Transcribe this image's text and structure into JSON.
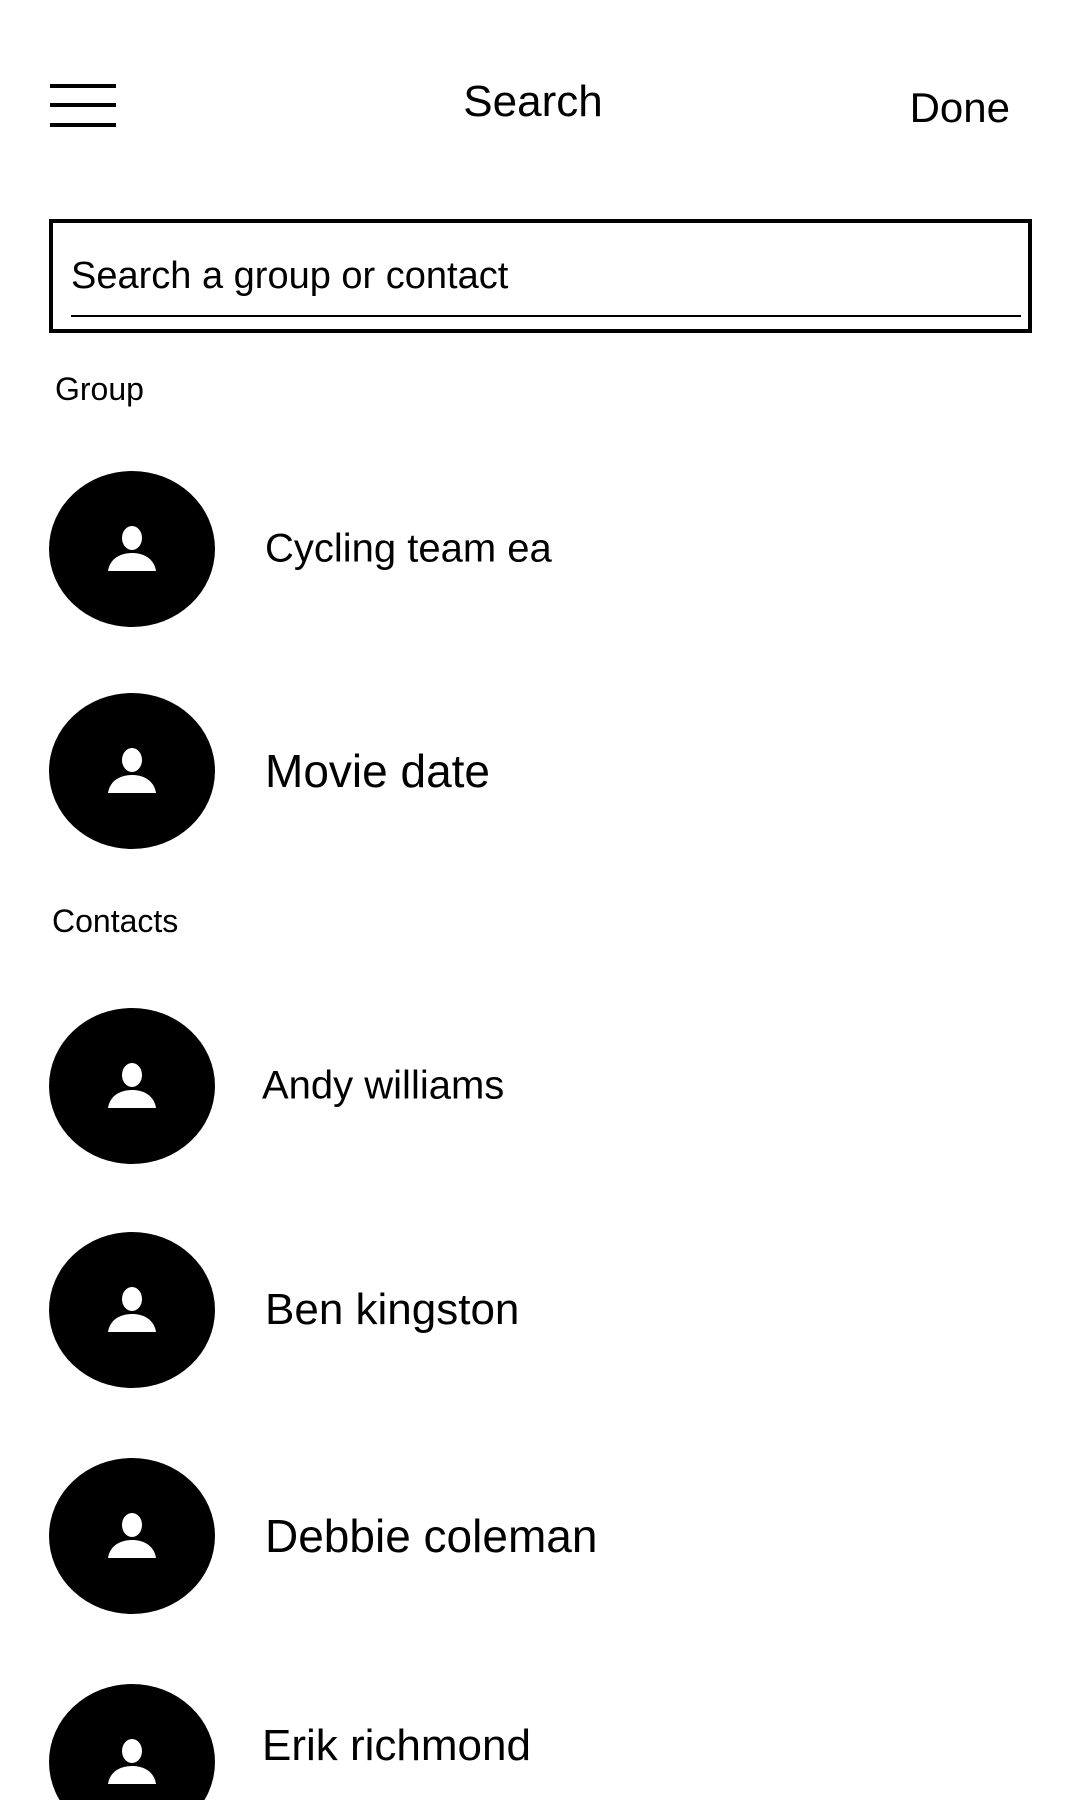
{
  "header": {
    "title": "Search",
    "done_label": "Done",
    "menu_icon": "hamburger-menu-icon"
  },
  "search": {
    "placeholder": "Search a group or contact",
    "value": ""
  },
  "sections": {
    "group_label": "Group",
    "contacts_label": "Contacts"
  },
  "groups": [
    {
      "name": "Cycling team ea",
      "icon": "person-icon"
    },
    {
      "name": "Movie date",
      "icon": "person-icon"
    }
  ],
  "contacts": [
    {
      "name": "Andy williams",
      "icon": "person-icon"
    },
    {
      "name": "Ben kingston",
      "icon": "person-icon"
    },
    {
      "name": "Debbie coleman",
      "icon": "person-icon"
    },
    {
      "name": "Erik richmond",
      "icon": "person-icon"
    }
  ],
  "colors": {
    "background": "#ffffff",
    "foreground": "#000000"
  }
}
